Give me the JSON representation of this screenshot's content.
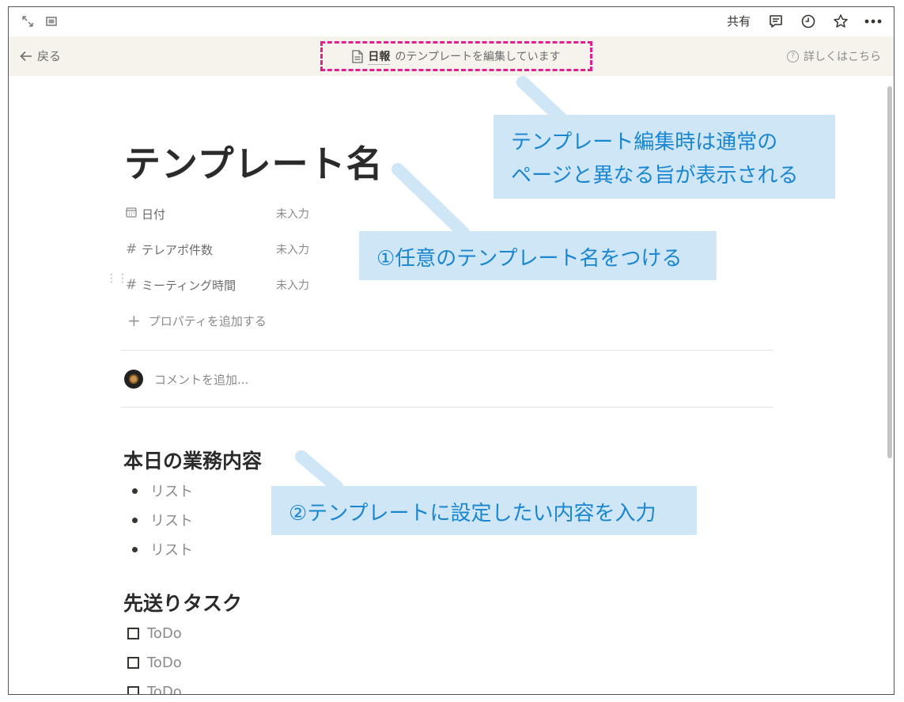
{
  "topbar": {
    "share_label": "共有"
  },
  "banner": {
    "back_label": "戻る",
    "template_name": "日報",
    "editing_text": "のテンプレートを編集しています",
    "learn_more": "詳しくはこちら"
  },
  "page": {
    "title": "テンプレート名",
    "properties": [
      {
        "icon": "calendar-icon",
        "name": "日付",
        "value": "未入力"
      },
      {
        "icon": "hash-icon",
        "name": "テレアポ件数",
        "value": "未入力"
      },
      {
        "icon": "hash-icon",
        "name": "ミーティング時間",
        "value": "未入力"
      }
    ],
    "add_property": "プロパティを追加する",
    "comment_placeholder": "コメントを追加...",
    "section1": {
      "heading": "本日の業務内容",
      "items": [
        "リスト",
        "リスト",
        "リスト"
      ]
    },
    "section2": {
      "heading": "先送りタスク",
      "items": [
        "ToDo",
        "ToDo",
        "ToDo"
      ]
    }
  },
  "callouts": {
    "banner_note": [
      "テンプレート編集時は通常の",
      "ページと異なる旨が表示される"
    ],
    "step1": "①任意のテンプレート名をつける",
    "step2": "②テンプレートに設定したい内容を入力"
  },
  "colors": {
    "callout_bg": "#cfe6f7",
    "callout_text": "#1a86cf",
    "highlight_border": "#e0208f",
    "banner_bg": "#f6f3ec"
  }
}
